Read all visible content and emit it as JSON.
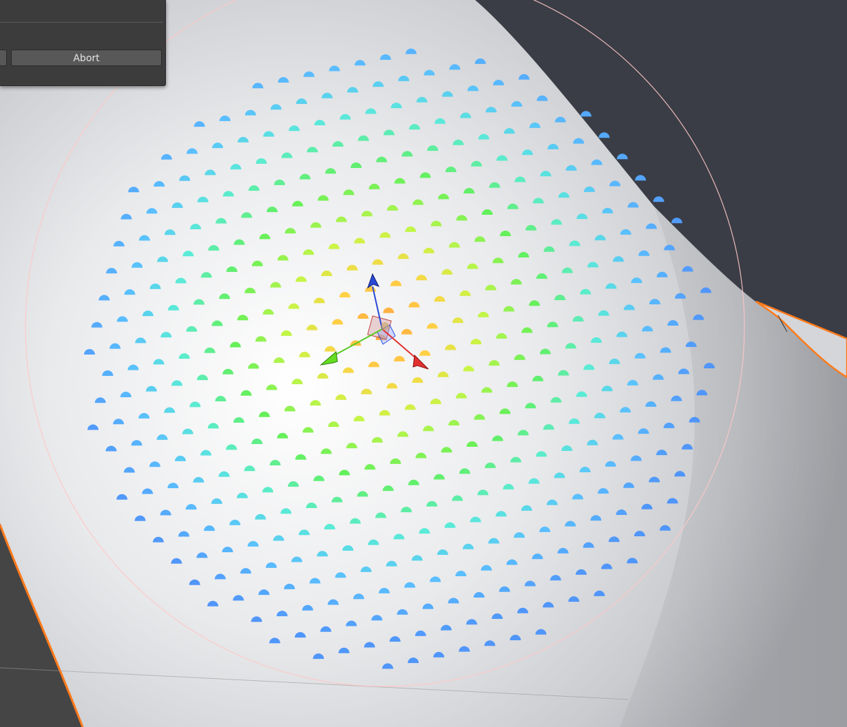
{
  "dialog": {
    "abort_label": "Abort",
    "colors": {
      "panel_bg": "#3c3c3c",
      "button_bg": "#585858",
      "button_text": "#e4e4e4"
    }
  },
  "viewport": {
    "colors": {
      "background": "#3a3d45",
      "mesh_surface": "#e6e7e9",
      "selection_outline": "#ff7a1a",
      "brush_circle": "#ffc8c8",
      "gradient_center": "#ffa040",
      "gradient_mid": "#66ee55",
      "gradient_edge": "#55a0ff"
    },
    "gizmo": {
      "x_axis_color": "#e23030",
      "y_axis_color": "#55cc22",
      "z_axis_color": "#2a48d6"
    },
    "icons": [
      "gizmo-x-arrow-icon",
      "gizmo-y-arrow-icon",
      "gizmo-z-arrow-icon",
      "gizmo-plane-handle-icon"
    ]
  }
}
